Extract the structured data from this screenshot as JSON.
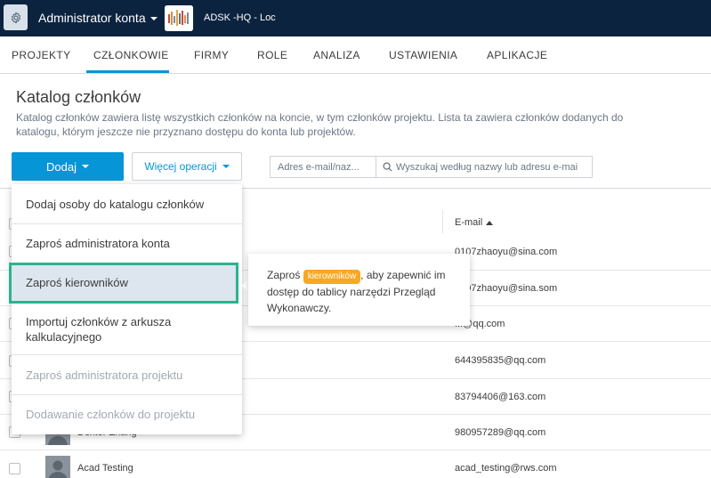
{
  "topbar": {
    "account_title": "Administrator konta",
    "project_name": "ADSK -HQ - Loc",
    "icons": {
      "settings": "gear-icon",
      "project": "project-thumbnail"
    }
  },
  "nav": {
    "tabs": [
      {
        "label": "PROJEKTY"
      },
      {
        "label": "CZŁONKOWIE",
        "active": true
      },
      {
        "label": "FIRMY"
      },
      {
        "label": "ROLE"
      },
      {
        "label": "ANALIZA"
      },
      {
        "label": "USTAWIENIA"
      },
      {
        "label": "APLIKACJE"
      }
    ]
  },
  "header": {
    "title": "Katalog członków",
    "description": "Katalog członków zawiera listę wszystkich członków na koncie, w tym członków projektu. Lista ta zawiera członków dodanych do katalogu, którym jeszcze nie przyznano dostępu do konta lub projektów."
  },
  "toolbar": {
    "add_label": "Dodaj",
    "more_label": "Więcej operacji",
    "filter_value": "Adres e-mail/naz...",
    "search_placeholder": "Wyszukaj według nazwy lub adresu e-mai"
  },
  "table": {
    "email_header": "E-mail",
    "rows": [
      {
        "name": "",
        "email": "0107zhaoyu@sina.com"
      },
      {
        "name": "",
        "email": "0107zhaoyu@sina.som"
      },
      {
        "name": "",
        "email": "...@qq.com"
      },
      {
        "name": "",
        "email": "644395835@qq.com"
      },
      {
        "name": "",
        "email": "83794406@163.com"
      },
      {
        "name": "Dexter Zhang",
        "email": "980957289@qq.com"
      },
      {
        "name": "Acad Testing",
        "email": "acad_testing@rws.com"
      }
    ]
  },
  "dropdown": {
    "items": [
      {
        "label": "Dodaj osoby do katalogu członków",
        "disabled": false
      },
      {
        "label": "Zaproś administratora konta",
        "disabled": false
      },
      {
        "label": "Zaproś kierowników",
        "disabled": false,
        "highlighted": true
      },
      {
        "label": "Importuj członków z arkusza kalkulacyjnego",
        "disabled": false
      },
      {
        "label": "Zaproś administratora projektu",
        "disabled": true
      },
      {
        "label": "Dodawanie członków do projektu",
        "disabled": true
      }
    ]
  },
  "tooltip": {
    "prefix": "Zaproś",
    "badge": "kierowników",
    "suffix": ", aby zapewnić im dostęp do tablicy narzędzi Przegląd Wykonawczy."
  },
  "colors": {
    "topbar_bg": "#0c2340",
    "accent": "#0696d7",
    "highlight_border": "#2bb38f",
    "badge": "#f8a822"
  }
}
